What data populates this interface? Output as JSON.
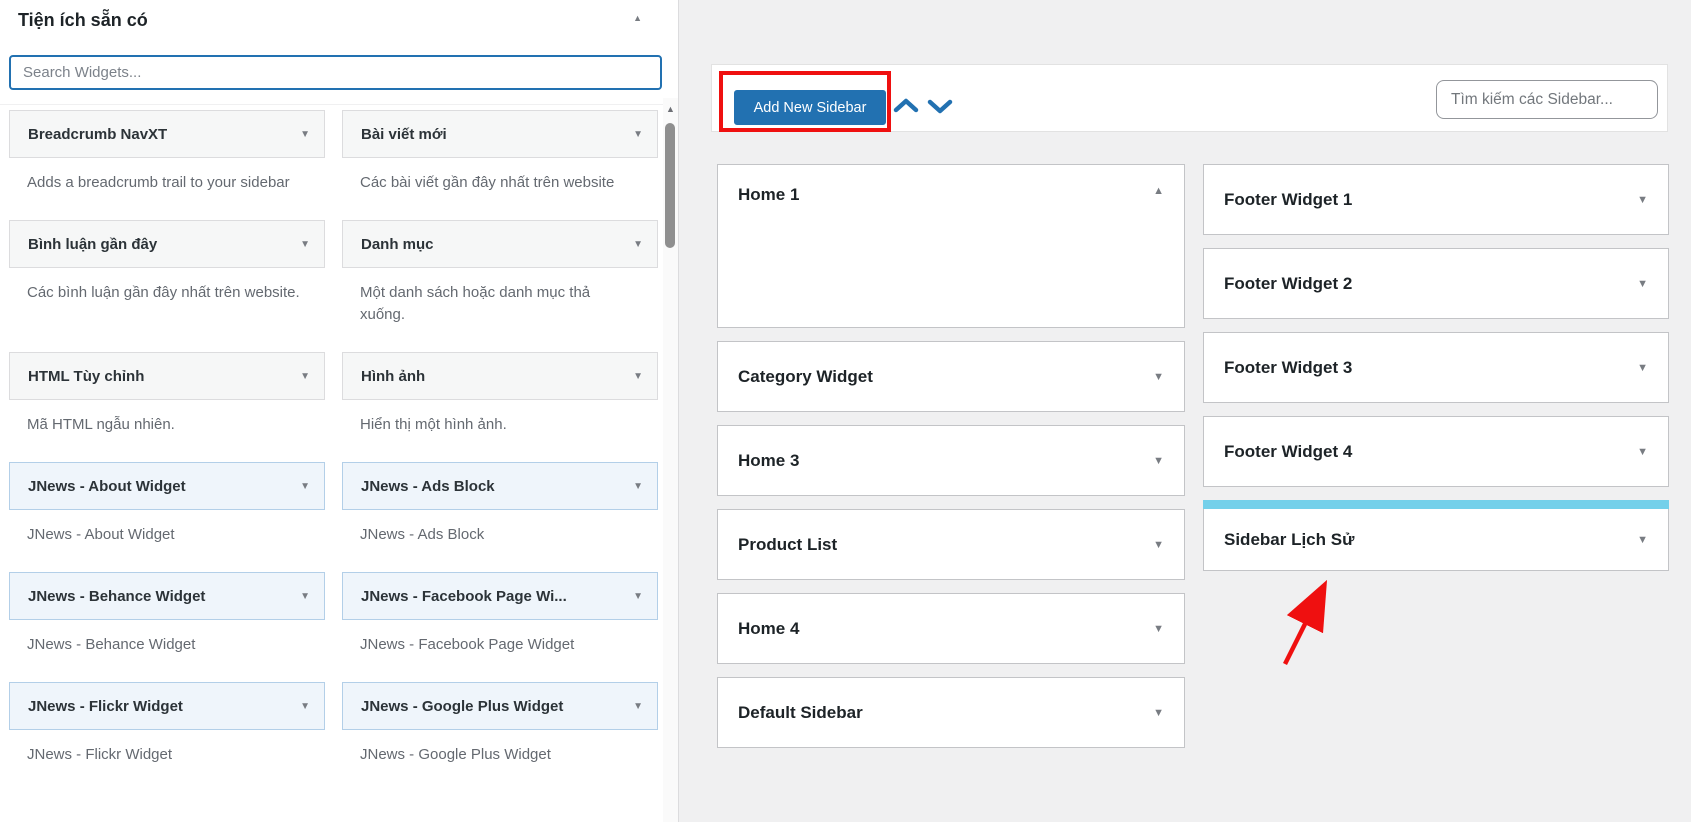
{
  "left_panel": {
    "title": "Tiện ích sẵn có",
    "search_placeholder": "Search Widgets...",
    "widgets": [
      {
        "name": "Breadcrumb NavXT",
        "description": "Adds a breadcrumb trail to your sidebar",
        "jnews": false
      },
      {
        "name": "Bài viết mới",
        "description": "Các bài viết gần đây nhất trên website",
        "jnews": false
      },
      {
        "name": "Bình luận gần đây",
        "description": "Các bình luận gần đây nhất trên website.",
        "jnews": false
      },
      {
        "name": "Danh mục",
        "description": "Một danh sách hoặc danh mục thả xuống.",
        "jnews": false
      },
      {
        "name": "HTML Tùy chỉnh",
        "description": "Mã HTML ngẫu nhiên.",
        "jnews": false
      },
      {
        "name": "Hình ảnh",
        "description": "Hiển thị một hình ảnh.",
        "jnews": false
      },
      {
        "name": "JNews - About Widget",
        "description": "JNews - About Widget",
        "jnews": true
      },
      {
        "name": "JNews - Ads Block",
        "description": "JNews - Ads Block",
        "jnews": true
      },
      {
        "name": "JNews - Behance Widget",
        "description": "JNews - Behance Widget",
        "jnews": true
      },
      {
        "name": "JNews - Facebook Page Wi...",
        "description": "JNews - Facebook Page Widget",
        "jnews": true
      },
      {
        "name": "JNews - Flickr Widget",
        "description": "JNews - Flickr Widget",
        "jnews": true
      },
      {
        "name": "JNews - Google Plus Widget",
        "description": "JNews - Google Plus Widget",
        "jnews": true
      }
    ]
  },
  "toolbar": {
    "add_button": "Add New Sidebar",
    "search_placeholder": "Tìm kiếm các Sidebar..."
  },
  "sidebars": {
    "column_a": [
      {
        "title": "Home 1",
        "expanded": true
      },
      {
        "title": "Category Widget"
      },
      {
        "title": "Home 3"
      },
      {
        "title": "Product List"
      },
      {
        "title": "Home 4"
      },
      {
        "title": "Default Sidebar"
      }
    ],
    "column_b": [
      {
        "title": "Footer Widget 1"
      },
      {
        "title": "Footer Widget 2"
      },
      {
        "title": "Footer Widget 3"
      },
      {
        "title": "Footer Widget 4"
      },
      {
        "title": "Sidebar Lịch Sử",
        "highlighted": true
      }
    ]
  },
  "colors": {
    "accent_blue": "#2271b1",
    "highlight_bar_blue": "#74d0ea",
    "annotation_red": "#ef1010"
  }
}
